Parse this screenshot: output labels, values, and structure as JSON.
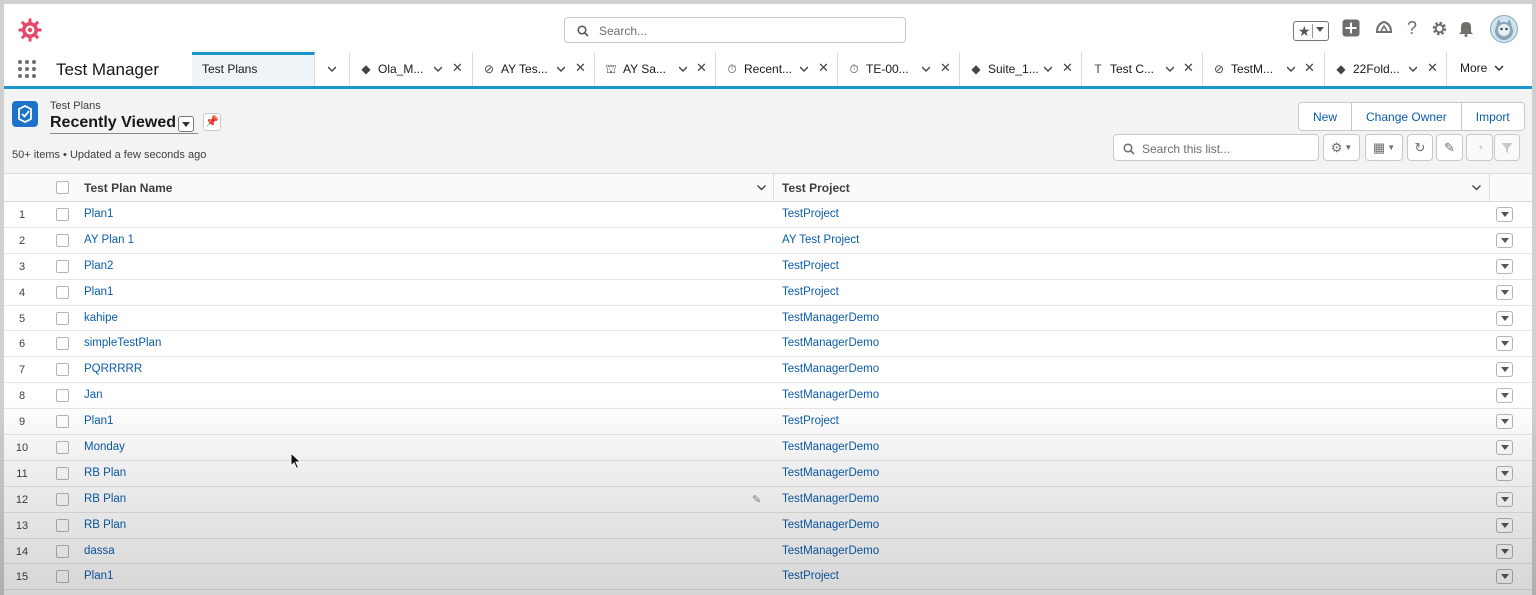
{
  "global_header": {
    "search_placeholder": "Search...",
    "icons": [
      "app-logo-icon",
      "search-icon",
      "star-icon",
      "add-icon",
      "trailhead-icon",
      "help-icon",
      "gear-icon",
      "bell-icon",
      "avatar"
    ]
  },
  "nav": {
    "app_name": "Test Manager",
    "tabs": [
      {
        "label": "Test Plans",
        "icon": "",
        "active": true
      },
      {
        "label": "Ola_M...",
        "icon": "diamond-icon"
      },
      {
        "label": "AY Tes...",
        "icon": "compass-icon"
      },
      {
        "label": "AY Sa...",
        "icon": "building-icon"
      },
      {
        "label": "Recent...",
        "icon": "timer-icon"
      },
      {
        "label": "TE-00...",
        "icon": "timer-icon"
      },
      {
        "label": "Suite_1...",
        "icon": "diamond-icon"
      },
      {
        "label": "Test C...",
        "icon": "text-icon"
      },
      {
        "label": "TestM...",
        "icon": "compass-icon"
      },
      {
        "label": "22Fold...",
        "icon": "diamond-icon"
      }
    ],
    "more_label": "More"
  },
  "list_header": {
    "object_label": "Test Plans",
    "view_name": "Recently Viewed",
    "meta": "50+ items • Updated a few seconds ago",
    "buttons": {
      "new": "New",
      "change_owner": "Change Owner",
      "import": "Import"
    },
    "search_placeholder": "Search this list..."
  },
  "table": {
    "columns": [
      "Test Plan Name",
      "Test Project"
    ],
    "rows": [
      {
        "num": "1",
        "name": "Plan1",
        "project": "TestProject"
      },
      {
        "num": "2",
        "name": "AY Plan 1",
        "project": "AY Test Project"
      },
      {
        "num": "3",
        "name": "Plan2",
        "project": "TestProject"
      },
      {
        "num": "4",
        "name": "Plan1",
        "project": "TestProject"
      },
      {
        "num": "5",
        "name": "kahipe",
        "project": "TestManagerDemo"
      },
      {
        "num": "6",
        "name": "simpleTestPlan",
        "project": "TestManagerDemo"
      },
      {
        "num": "7",
        "name": "PQRRRRR",
        "project": "TestManagerDemo"
      },
      {
        "num": "8",
        "name": "Jan",
        "project": "TestManagerDemo"
      },
      {
        "num": "9",
        "name": "Plan1",
        "project": "TestProject"
      },
      {
        "num": "10",
        "name": "Monday",
        "project": "TestManagerDemo"
      },
      {
        "num": "11",
        "name": "RB Plan",
        "project": "TestManagerDemo"
      },
      {
        "num": "12",
        "name": "RB Plan",
        "project": "TestManagerDemo"
      },
      {
        "num": "13",
        "name": "RB Plan",
        "project": "TestManagerDemo"
      },
      {
        "num": "14",
        "name": "dassa",
        "project": "TestManagerDemo"
      },
      {
        "num": "15",
        "name": "Plan1",
        "project": "TestProject"
      }
    ]
  },
  "colors": {
    "accent": "#1b96c9",
    "link": "#0b5cab",
    "object_icon": "#1d73c9",
    "logo": "#e8456b"
  }
}
